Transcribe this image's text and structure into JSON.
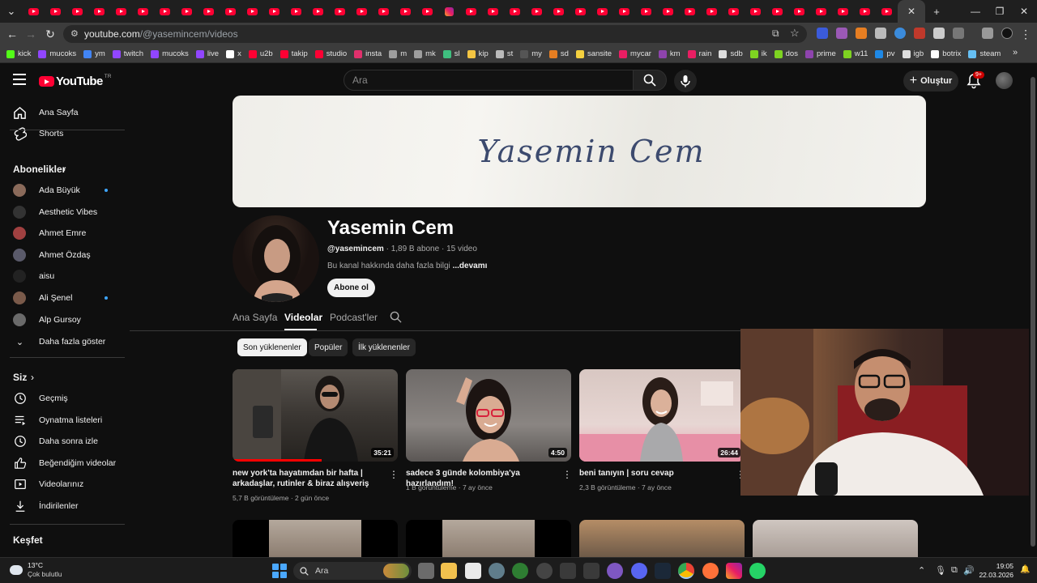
{
  "browser": {
    "tab_count": 40,
    "url_host": "youtube.com",
    "url_path": "/@yasemincem/videos",
    "bookmarks": [
      {
        "label": "kick",
        "color": "#53fc18"
      },
      {
        "label": "mucoks",
        "color": "#9146ff"
      },
      {
        "label": "ym",
        "color": "#4285f4"
      },
      {
        "label": "twitch",
        "color": "#9146ff"
      },
      {
        "label": "mucoks",
        "color": "#9146ff"
      },
      {
        "label": "live",
        "color": "#9146ff"
      },
      {
        "label": "x",
        "color": "#ffffff"
      },
      {
        "label": "u2b",
        "color": "#ff0033"
      },
      {
        "label": "takip",
        "color": "#ff0033"
      },
      {
        "label": "studio",
        "color": "#ff0033"
      },
      {
        "label": "insta",
        "color": "#e1306c"
      },
      {
        "label": "m",
        "color": "#9e9e9e"
      },
      {
        "label": "mk",
        "color": "#9e9e9e"
      },
      {
        "label": "sl",
        "color": "#3fbf7f"
      },
      {
        "label": "kip",
        "color": "#f4c542"
      },
      {
        "label": "st",
        "color": "#bbbbbb"
      },
      {
        "label": "my",
        "color": "#555555"
      },
      {
        "label": "sd",
        "color": "#e67e22"
      },
      {
        "label": "sansite",
        "color": "#f4d03f"
      },
      {
        "label": "mycar",
        "color": "#e91e63"
      },
      {
        "label": "km",
        "color": "#8e44ad"
      },
      {
        "label": "rain",
        "color": "#e91e63"
      },
      {
        "label": "sdb",
        "color": "#dddddd"
      },
      {
        "label": "ik",
        "color": "#7ed321"
      },
      {
        "label": "dos",
        "color": "#7ed321"
      },
      {
        "label": "prime",
        "color": "#8e44ad"
      },
      {
        "label": "w11",
        "color": "#7ed321"
      },
      {
        "label": "pv",
        "color": "#1e88e5"
      },
      {
        "label": "igb",
        "color": "#dddddd"
      },
      {
        "label": "botrix",
        "color": "#ffffff"
      },
      {
        "label": "steam",
        "color": "#66c0f4"
      }
    ]
  },
  "header": {
    "logo_text": "YouTube",
    "logo_region": "TR",
    "search_placeholder": "Ara",
    "create_label": "Oluştur",
    "notifications_badge": "9+"
  },
  "sidebar": {
    "main_items": [
      {
        "label": "Ana Sayfa",
        "icon": "home-icon"
      },
      {
        "label": "Shorts",
        "icon": "shorts-icon"
      }
    ],
    "subscriptions_title": "Abonelikler",
    "subscriptions": [
      {
        "label": "Ada Büyük",
        "new": true,
        "color": "#8a6a5a"
      },
      {
        "label": "Aesthetic Vibes",
        "new": false,
        "color": "#333333"
      },
      {
        "label": "Ahmet Emre",
        "new": false,
        "color": "#a04040"
      },
      {
        "label": "Ahmet Özdaş",
        "new": false,
        "color": "#5a5a6a"
      },
      {
        "label": "aisu",
        "new": false,
        "color": "#222222"
      },
      {
        "label": "Ali Şenel",
        "new": true,
        "color": "#7a5a4a"
      },
      {
        "label": "Alp Gursoy",
        "new": false,
        "color": "#6a6a6a"
      }
    ],
    "show_more_label": "Daha fazla göster",
    "you_title": "Siz",
    "you_items": [
      {
        "label": "Geçmiş",
        "icon": "history-icon"
      },
      {
        "label": "Oynatma listeleri",
        "icon": "playlists-icon"
      },
      {
        "label": "Daha sonra izle",
        "icon": "watch-later-icon"
      },
      {
        "label": "Beğendiğim videolar",
        "icon": "liked-icon"
      },
      {
        "label": "Videolarınız",
        "icon": "your-videos-icon"
      },
      {
        "label": "İndirilenler",
        "icon": "downloads-icon"
      }
    ],
    "explore_title": "Keşfet"
  },
  "channel": {
    "banner_text": "Yasemin Cem",
    "name": "Yasemin Cem",
    "handle": "@yasemincem",
    "subscribers": "1,89 B abone",
    "video_count": "15 video",
    "description": "Bu kanal hakkında daha fazla bilgi",
    "more_label": "...devamı",
    "subscribe_label": "Abone ol",
    "tabs": [
      {
        "label": "Ana Sayfa",
        "active": false
      },
      {
        "label": "Videolar",
        "active": true
      },
      {
        "label": "Podcast'ler",
        "active": false
      }
    ],
    "filter_chips": [
      {
        "label": "Son yüklenenler",
        "active": true
      },
      {
        "label": "Popüler",
        "active": false
      },
      {
        "label": "İlk yüklenenler",
        "active": false
      }
    ]
  },
  "videos": [
    {
      "title": "new york'ta hayatımdan bir hafta | arkadaşlar, rutinler & biraz alışveriş",
      "duration": "35:21",
      "views": "5,7 B görüntüleme",
      "age": "2 gün önce",
      "watched_fraction": 0.54
    },
    {
      "title": "sadece 3 günde kolombiya'ya hazırlandım!",
      "duration": "4:50",
      "views": "1 B görüntüleme",
      "age": "7 ay önce",
      "watched_fraction": 0
    },
    {
      "title": "beni tanıyın | soru cevap",
      "duration": "26:44",
      "views": "2,3 B görüntüleme",
      "age": "7 ay önce",
      "watched_fraction": 0
    }
  ],
  "taskbar": {
    "temperature": "13°C",
    "weather": "Çok bulutlu",
    "search_label": "Ara",
    "time": "19:05",
    "date": "22.03.2026"
  }
}
